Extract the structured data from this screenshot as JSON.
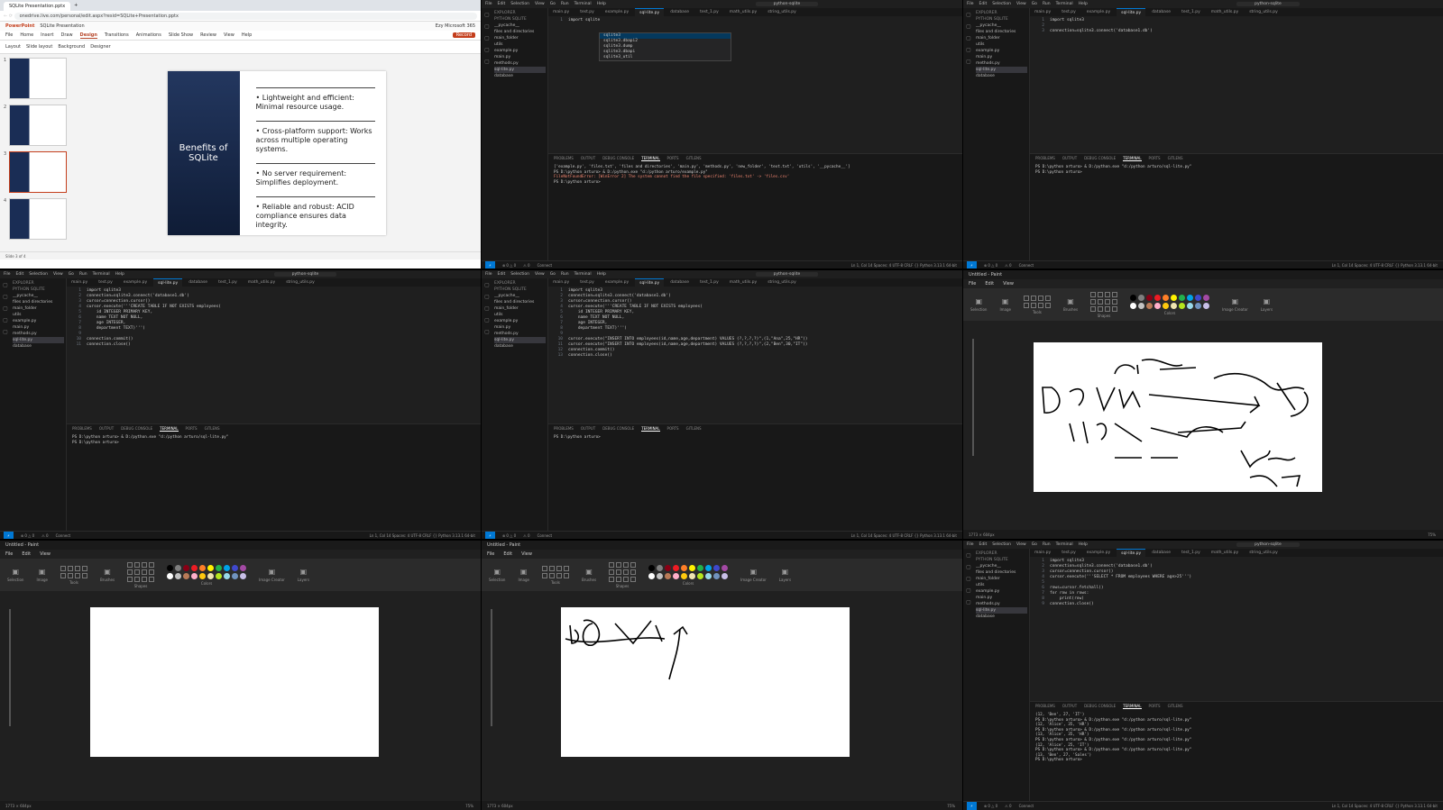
{
  "browser": {
    "tab_title": "SQLite Presentation.pptx",
    "url": "onedrive.live.com/personal/edit.aspx?resid=SQLite+Presentation.pptx",
    "app_title": "PowerPoint",
    "file_title": "SQLite Presentation",
    "account": "Ezy Microsoft 365",
    "menu": [
      "File",
      "Home",
      "Insert",
      "Draw",
      "Design",
      "Transitions",
      "Animations",
      "Slide Show",
      "Review",
      "View",
      "Help"
    ],
    "active_menu": "Design",
    "record_btn": "Record",
    "toolbar": [
      "Layout",
      "Slide layout",
      "Background",
      "Designer"
    ],
    "thumbs": [
      "1",
      "2",
      "3",
      "4"
    ],
    "slide": {
      "title": "Benefits of SQLite",
      "bullets": [
        "Lightweight and efficient: Minimal resource usage.",
        "Cross-platform support: Works across multiple operating systems.",
        "No server requirement: Simplifies deployment.",
        "Reliable and robust: ACID compliance ensures data integrity."
      ]
    },
    "status": "Slide 3 of 4"
  },
  "vscode": {
    "menu": [
      "File",
      "Edit",
      "Selection",
      "View",
      "Go",
      "Run",
      "Terminal",
      "Help"
    ],
    "window_title": "python-sqlite",
    "explorer_title": "EXPLORER",
    "project": "PYTHON SQLITE",
    "files": [
      "__pycache__",
      "files and directories",
      "main_folder",
      "utils",
      "example.py",
      "main.py",
      "methods.py",
      "sql-lite.py",
      "database"
    ],
    "selected_file": "sql-lite.py",
    "tabs": [
      "main.py",
      "test.py",
      "example.py",
      "sql-lite.py",
      "database",
      "test_1.py",
      "math_utils.py",
      "string_utils.py"
    ],
    "active_tab": "sql-lite.py",
    "panel_tabs": [
      "PROBLEMS",
      "OUTPUT",
      "DEBUG CONSOLE",
      "TERMINAL",
      "PORTS",
      "GITLENS"
    ],
    "active_panel": "TERMINAL",
    "status_remote": "⚡",
    "status_left": [
      "⊗ 0 △ 0",
      "⚠ 0",
      "Connect"
    ],
    "status_right": "Ln 1, Col 14   Spaces: 4   UTF-8   CRLF   {} Python   3.13.1 64-bit",
    "prompt": "PS D:\\python arturo> ",
    "code_import": [
      "import sqlite"
    ],
    "autocomplete": [
      "sqlite3",
      "sqlite3.dbapi2",
      "sqlite3.dump",
      "sqlite3.dbapi",
      "sqlite3_util"
    ],
    "term_a": [
      "['example.py', 'files.txt', 'files and directories', 'main.py', 'methods.py', 'new_folder', 'text.txt', 'utils', '__pycache__']",
      "PS D:\\python arturo> & D:/python.exe \"d:/python arturo/example.py\"",
      "FileNotFoundError: [WinError 2] The system cannot find the file specified: 'files.txt' -> 'files.csv'",
      "PS D:\\python arturo> "
    ],
    "code_connect": [
      "import sqlite3",
      "",
      "connection=sqlite3.connect('database1.db')"
    ],
    "term_b": [
      "PS D:\\python arturo> & D:/python.exe \"d:/python arturo/sql-lite.py\"",
      "PS D:\\python arturo> "
    ],
    "code_create": [
      "import sqlite3",
      "connection=sqlite3.connect('database1.db')",
      "cursor=connection.cursor()",
      "cursor.execute('''CREATE TABLE IF NOT EXISTS employees(",
      "    id INTEGER PRIMARY KEY,",
      "    name TEXT NOT NULL,",
      "    age INTEGER,",
      "    department TEXT)''')",
      "",
      "connection.commit()",
      "connection.close()"
    ],
    "term_c": [
      "PS D:\\python arturo> & D:/python.exe \"d:/python arturo/sql-lite.py\"",
      "PS D:\\python arturo> "
    ],
    "code_insert": [
      "import sqlite3",
      "connection=sqlite3.connect('database1.db')",
      "cursor=connection.cursor()",
      "cursor.execute('''CREATE TABLE IF NOT EXISTS employees(",
      "    id INTEGER PRIMARY KEY,",
      "    name TEXT NOT NULL,",
      "    age INTEGER,",
      "    department TEXT)''')",
      "",
      "cursor.execute(\"INSERT INTO employees(id,name,age,department) VALUES (?,?,?,?)\",(1,\"Ana\",25,\"HR\"))",
      "cursor.execute(\"INSERT INTO employees(id,name,age,department) VALUES (?,?,?,?)\",(2,\"Ben\",30,\"IT\"))",
      "connection.commit()",
      "connection.close()"
    ],
    "term_d": [
      "PS D:\\python arturo> "
    ],
    "code_select": [
      "import sqlite3",
      "connection=sqlite3.connect('database1.db')",
      "cursor=connection.cursor()",
      "cursor.execute('''SELECT * FROM employees WHERE age>25''')",
      "",
      "rows=cursor.fetchall()",
      "for row in rows:",
      "    print(row)",
      "connection.close()"
    ],
    "term_e": [
      "(12, 'Ben', 27, 'IT')",
      "PS D:\\python arturo> & D:/python.exe \"d:/python arturo/sql-lite.py\"",
      "(12, 'Alice', 35, 'HR')",
      "PS D:\\python arturo> & D:/python.exe \"d:/python arturo/sql-lite.py\"",
      "(13, 'Alice', 35, 'HR')",
      "PS D:\\python arturo> & D:/python.exe \"d:/python arturo/sql-lite.py\"",
      "(12, 'Alice', 25, 'IT')",
      "PS D:\\python arturo> & D:/python.exe \"d:/python arturo/sql-lite.py\"",
      "(13, 'Ben', 27, 'Sales')",
      "PS D:\\python arturo> "
    ]
  },
  "paint": {
    "title": "Untitled - Paint",
    "menu": [
      "File",
      "Edit",
      "View"
    ],
    "groups": [
      "Selection",
      "Image",
      "Tools",
      "Brushes",
      "Shapes",
      "Colors",
      "Image Creator",
      "Layers"
    ],
    "status_left": "1773 × 604px",
    "zoom": "75%",
    "palette": [
      "#000000",
      "#7f7f7f",
      "#880015",
      "#ed1c24",
      "#ff7f27",
      "#fff200",
      "#22b14c",
      "#00a2e8",
      "#3f48cc",
      "#a349a4",
      "#ffffff",
      "#c3c3c3",
      "#b97a57",
      "#ffaec9",
      "#ffc90e",
      "#efe4b0",
      "#b5e61d",
      "#99d9ea",
      "#7092be",
      "#c8bfe7"
    ]
  }
}
